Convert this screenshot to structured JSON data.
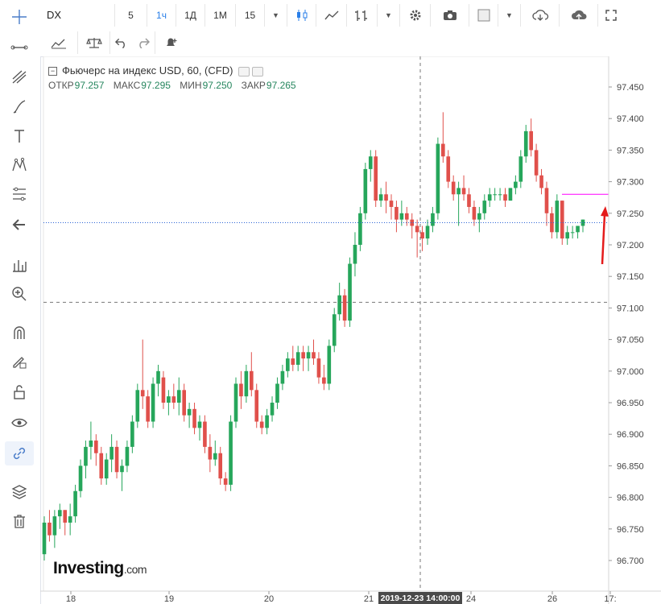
{
  "toolbar": {
    "symbol": "DX",
    "intervals": [
      {
        "label": "5",
        "active": false
      },
      {
        "label": "1ч",
        "active": true
      },
      {
        "label": "1Д",
        "active": false
      },
      {
        "label": "1М",
        "active": false
      },
      {
        "label": "15",
        "active": false
      }
    ]
  },
  "icons": [
    "crosshair-icon",
    "line-icon",
    "pitchfork-icon",
    "brush-icon",
    "text-icon",
    "pattern-icon",
    "fib-icon",
    "arrow-left-icon",
    "measure-icon",
    "zoom-icon",
    "magnet-icon",
    "lock-draw-icon",
    "lock-icon",
    "eye-icon",
    "link-icon",
    "layers-icon",
    "trash-icon",
    "candle-style-icon",
    "area-style-icon",
    "bar-style-icon",
    "settings-icon",
    "camera-icon",
    "rect-color-icon",
    "cloud-download-icon",
    "cloud-upload-icon",
    "fullscreen-icon",
    "indicators-icon",
    "compare-icon",
    "undo-icon",
    "redo-icon",
    "alert-icon"
  ],
  "legend": {
    "title": "Фьючерс на индекс USD, 60, (CFD)",
    "open_label": "ОТКР",
    "open": "97.257",
    "high_label": "МАКС",
    "high": "97.295",
    "low_label": "МИН",
    "low": "97.250",
    "close_label": "ЗАКР",
    "close": "97.265"
  },
  "logo": {
    "brand": "Investing",
    "suffix": ".com"
  },
  "colors": {
    "up": "#26a65b",
    "down": "#e0504b",
    "marker": "#ff00ff",
    "arrow": "#e41b1b",
    "price": "#2a64d6"
  },
  "chart_data": {
    "type": "candlestick",
    "y_axis": {
      "range": [
        96.68,
        97.47
      ],
      "ticks": [
        "97.450",
        "97.400",
        "97.350",
        "97.300",
        "97.250",
        "97.200",
        "97.150",
        "97.100",
        "97.050",
        "97.000",
        "96.950",
        "96.900",
        "96.850",
        "96.800",
        "96.750",
        "96.700"
      ]
    },
    "x_axis": {
      "ticks": [
        "18",
        "19",
        "20",
        "21",
        "24",
        "26",
        "17:"
      ],
      "crosshair_label": "2019-12-23 14:00:00"
    },
    "price_labels": [
      {
        "label": "97.280",
        "value": 97.28,
        "kind": "marker"
      },
      {
        "label": "97.235",
        "value": 97.235,
        "kind": "last"
      },
      {
        "label": "97.109",
        "value": 97.109,
        "kind": "crosshair"
      }
    ],
    "candles": [
      [
        96.71,
        96.77,
        96.7,
        96.76
      ],
      [
        96.76,
        96.78,
        96.73,
        96.74
      ],
      [
        96.74,
        96.78,
        96.72,
        96.77
      ],
      [
        96.77,
        96.79,
        96.75,
        96.78
      ],
      [
        96.78,
        96.78,
        96.74,
        96.76
      ],
      [
        96.76,
        96.79,
        96.74,
        96.77
      ],
      [
        96.77,
        96.82,
        96.76,
        96.81
      ],
      [
        96.81,
        96.86,
        96.8,
        96.85
      ],
      [
        96.85,
        96.89,
        96.83,
        96.88
      ],
      [
        96.88,
        96.92,
        96.86,
        96.89
      ],
      [
        96.89,
        96.9,
        96.85,
        96.87
      ],
      [
        96.87,
        96.88,
        96.82,
        96.83
      ],
      [
        96.83,
        96.87,
        96.82,
        96.86
      ],
      [
        96.86,
        96.9,
        96.84,
        96.88
      ],
      [
        96.88,
        96.89,
        96.83,
        96.84
      ],
      [
        96.84,
        96.86,
        96.81,
        96.85
      ],
      [
        96.85,
        96.89,
        96.84,
        96.88
      ],
      [
        96.88,
        96.93,
        96.87,
        96.92
      ],
      [
        96.92,
        96.98,
        96.91,
        96.97
      ],
      [
        96.97,
        97.05,
        96.94,
        96.96
      ],
      [
        96.96,
        96.97,
        96.91,
        96.92
      ],
      [
        96.92,
        96.99,
        96.91,
        96.98
      ],
      [
        96.98,
        97.01,
        96.96,
        97.0
      ],
      [
        96.99,
        97.0,
        96.94,
        96.95
      ],
      [
        96.95,
        96.97,
        96.93,
        96.96
      ],
      [
        96.96,
        96.98,
        96.94,
        96.95
      ],
      [
        96.95,
        96.99,
        96.93,
        96.97
      ],
      [
        96.97,
        96.98,
        96.92,
        96.93
      ],
      [
        96.93,
        96.95,
        96.91,
        96.94
      ],
      [
        96.94,
        96.95,
        96.9,
        96.91
      ],
      [
        96.91,
        96.93,
        96.89,
        96.92
      ],
      [
        96.92,
        96.93,
        96.87,
        96.88
      ],
      [
        96.88,
        96.9,
        96.84,
        96.86
      ],
      [
        96.86,
        96.89,
        96.85,
        96.87
      ],
      [
        96.87,
        96.88,
        96.82,
        96.83
      ],
      [
        96.83,
        96.84,
        96.81,
        96.82
      ],
      [
        96.82,
        96.93,
        96.81,
        96.92
      ],
      [
        96.92,
        96.99,
        96.91,
        96.98
      ],
      [
        96.98,
        97.0,
        96.94,
        96.96
      ],
      [
        96.96,
        97.01,
        96.95,
        97.0
      ],
      [
        97.0,
        97.03,
        96.96,
        96.97
      ],
      [
        96.97,
        96.98,
        96.91,
        96.92
      ],
      [
        96.92,
        96.93,
        96.9,
        96.91
      ],
      [
        96.91,
        96.94,
        96.9,
        96.93
      ],
      [
        96.93,
        96.96,
        96.92,
        96.95
      ],
      [
        96.95,
        96.99,
        96.94,
        96.98
      ],
      [
        96.98,
        97.01,
        96.97,
        97.0
      ],
      [
        97.0,
        97.03,
        96.99,
        97.02
      ],
      [
        97.02,
        97.04,
        97.0,
        97.01
      ],
      [
        97.01,
        97.04,
        97.0,
        97.03
      ],
      [
        97.03,
        97.04,
        97.0,
        97.02
      ],
      [
        97.02,
        97.04,
        97.0,
        97.03
      ],
      [
        97.03,
        97.05,
        97.01,
        97.02
      ],
      [
        97.02,
        97.03,
        96.98,
        96.99
      ],
      [
        96.99,
        97.01,
        96.97,
        96.98
      ],
      [
        96.98,
        97.05,
        96.97,
        97.04
      ],
      [
        97.04,
        97.1,
        97.03,
        97.09
      ],
      [
        97.09,
        97.14,
        97.08,
        97.12
      ],
      [
        97.12,
        97.13,
        97.07,
        97.08
      ],
      [
        97.08,
        97.18,
        97.07,
        97.17
      ],
      [
        97.17,
        97.22,
        97.15,
        97.2
      ],
      [
        97.2,
        97.26,
        97.19,
        97.25
      ],
      [
        97.25,
        97.33,
        97.24,
        97.32
      ],
      [
        97.32,
        97.35,
        97.3,
        97.34
      ],
      [
        97.34,
        97.35,
        97.26,
        97.27
      ],
      [
        97.27,
        97.29,
        97.26,
        97.28
      ],
      [
        97.28,
        97.3,
        97.25,
        97.27
      ],
      [
        97.27,
        97.28,
        97.24,
        97.26
      ],
      [
        97.26,
        97.27,
        97.22,
        97.24
      ],
      [
        97.24,
        97.27,
        97.23,
        97.25
      ],
      [
        97.25,
        97.26,
        97.23,
        97.24
      ],
      [
        97.24,
        97.25,
        97.21,
        97.23
      ],
      [
        97.23,
        97.24,
        97.18,
        97.22
      ],
      [
        97.22,
        97.23,
        97.19,
        97.21
      ],
      [
        97.21,
        97.24,
        97.2,
        97.23
      ],
      [
        97.23,
        97.26,
        97.22,
        97.25
      ],
      [
        97.25,
        97.37,
        97.24,
        97.36
      ],
      [
        97.36,
        97.41,
        97.33,
        97.34
      ],
      [
        97.34,
        97.35,
        97.29,
        97.3
      ],
      [
        97.3,
        97.31,
        97.27,
        97.28
      ],
      [
        97.28,
        97.3,
        97.23,
        97.29
      ],
      [
        97.29,
        97.31,
        97.27,
        97.28
      ],
      [
        97.28,
        97.29,
        97.25,
        97.26
      ],
      [
        97.26,
        97.27,
        97.23,
        97.24
      ],
      [
        97.24,
        97.26,
        97.22,
        97.25
      ],
      [
        97.25,
        97.28,
        97.24,
        97.27
      ],
      [
        97.27,
        97.29,
        97.26,
        97.28
      ],
      [
        97.28,
        97.29,
        97.27,
        97.28
      ],
      [
        97.28,
        97.29,
        97.27,
        97.28
      ],
      [
        97.28,
        97.29,
        97.26,
        97.27
      ],
      [
        97.27,
        97.29,
        97.27,
        97.29
      ],
      [
        97.29,
        97.31,
        97.28,
        97.3
      ],
      [
        97.3,
        97.35,
        97.29,
        97.34
      ],
      [
        97.34,
        97.39,
        97.33,
        97.38
      ],
      [
        97.38,
        97.4,
        97.34,
        97.35
      ],
      [
        97.35,
        97.36,
        97.3,
        97.31
      ],
      [
        97.31,
        97.32,
        97.28,
        97.29
      ],
      [
        97.29,
        97.3,
        97.23,
        97.25
      ],
      [
        97.25,
        97.26,
        97.21,
        97.22
      ],
      [
        97.22,
        97.28,
        97.21,
        97.27
      ],
      [
        97.27,
        97.27,
        97.2,
        97.21
      ],
      [
        97.21,
        97.23,
        97.2,
        97.22
      ],
      [
        97.22,
        97.23,
        97.21,
        97.22
      ],
      [
        97.22,
        97.23,
        97.21,
        97.23
      ],
      [
        97.23,
        97.24,
        97.22,
        97.24
      ]
    ]
  }
}
